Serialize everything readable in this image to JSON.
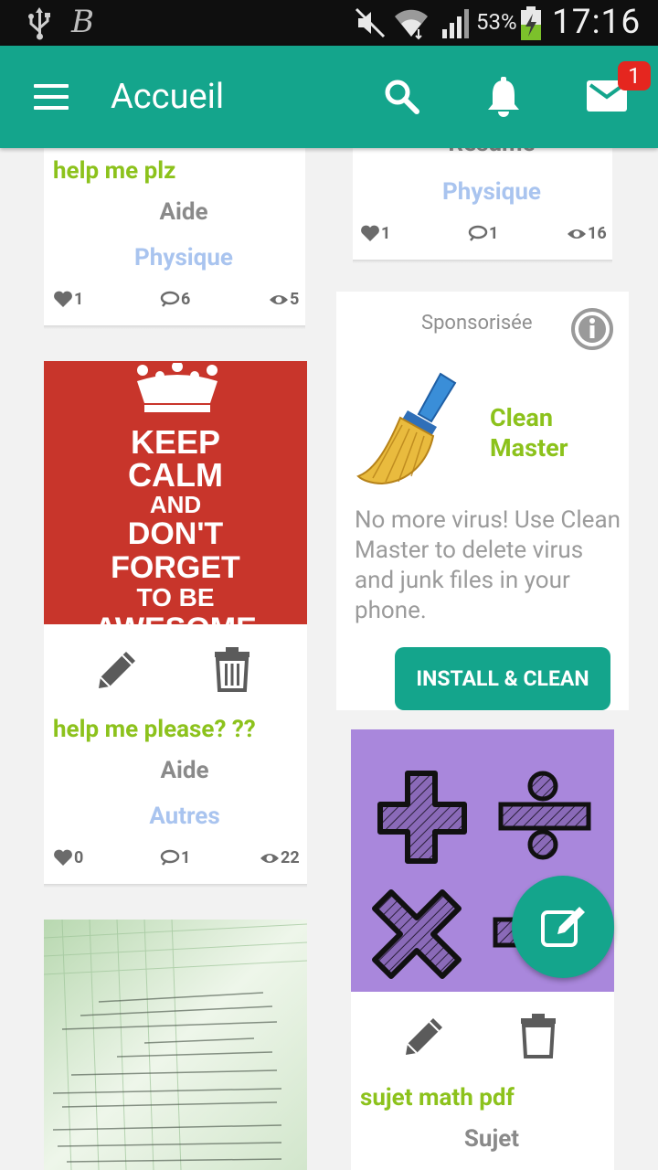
{
  "status_bar": {
    "battery": "53%",
    "time": "17:16"
  },
  "app_bar": {
    "title": "Accueil",
    "mail_badge": "1"
  },
  "cards": [
    {
      "title": "help me plz",
      "category": "Aide",
      "subject": "Physique",
      "likes": "1",
      "comments": "6",
      "views": "5"
    },
    {
      "partial_heading": "Résumé",
      "subject": "Physique",
      "likes": "1",
      "comments": "1",
      "views": "16"
    },
    {
      "image_text": [
        "KEEP",
        "CALM",
        "AND",
        "DON'T",
        "FORGET",
        "TO BE",
        "AWESOME"
      ],
      "title": "help me  please? ??",
      "category": "Aide",
      "subject": "Autres",
      "likes": "0",
      "comments": "1",
      "views": "22"
    },
    {
      "title": "sujet math pdf",
      "category": "Sujet"
    }
  ],
  "ad": {
    "label": "Sponsorisée",
    "app_name": "Clean Master",
    "description": "No more virus! Use Clean Master to delete virus and junk files in your phone.",
    "button": "INSTALL & CLEAN"
  },
  "colors": {
    "primary": "#14a58c",
    "title_green": "#8cc21c",
    "subject_blue": "#a9c4ef",
    "badge_red": "#e5261f"
  }
}
